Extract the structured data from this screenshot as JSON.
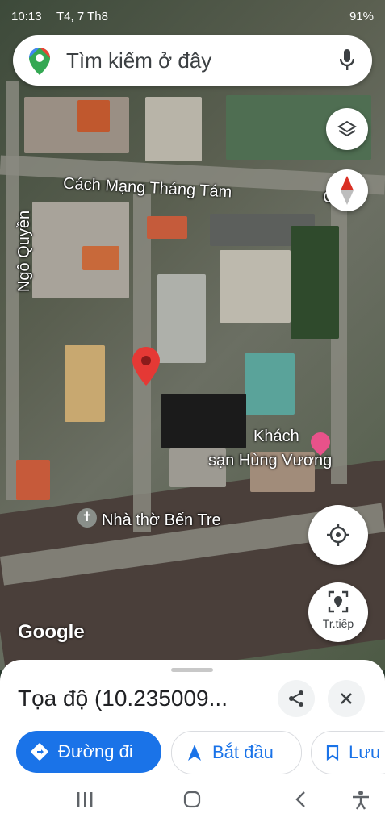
{
  "status": {
    "time": "10:13",
    "date": "T4, 7 Th8",
    "battery": "91%"
  },
  "search": {
    "placeholder": "Tìm kiếm ở đây"
  },
  "map_labels": {
    "street_main": "Cách Mạng Tháng Tám",
    "street_main_cut": "C M",
    "street_side": "Ngô Quyền",
    "hotel_line1": "Khách",
    "hotel_line2": "sạn Hùng Vương",
    "church": "Nhà thờ Bến Tre",
    "attribution": "Google",
    "live_view": "Tr.tiếp"
  },
  "sheet": {
    "coords": "Tọa độ (10.235009...",
    "directions": "Đường đi",
    "start": "Bắt đầu",
    "save": "Lưu"
  },
  "colors": {
    "accent": "#1a73e8",
    "pin": "#e53935",
    "compass_red": "#d93025"
  }
}
